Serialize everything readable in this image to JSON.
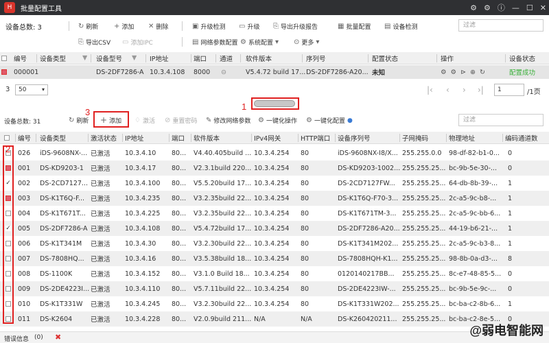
{
  "window": {
    "title": "批量配置工具",
    "controls": [
      "⚙",
      "⚙",
      "ⓘ",
      "—",
      "☐",
      "✕"
    ]
  },
  "top_toolbar": {
    "device_total_label": "设备总数: 3",
    "refresh": "刷新",
    "add": "添加",
    "delete": "删除",
    "upgrade_check": "升级检测",
    "upgrade": "升级",
    "export_report": "导出升级报告",
    "batch_config": "批量配置",
    "device_check": "设备检测",
    "export_csv": "导出CSV",
    "add_ipc": "添加IPC",
    "net_params": "网络参数配置",
    "sys_config": "系统配置",
    "more": "更多",
    "filter_placeholder": "过滤"
  },
  "top_table": {
    "headers": [
      "编号",
      "设备类型",
      "设备型号",
      "IP地址",
      "端口",
      "通道",
      "软件版本",
      "序列号",
      "配置状态",
      "操作",
      "设备状态"
    ],
    "rows": [
      {
        "num": "000001",
        "type": "",
        "model": "DS-2DF7286-A",
        "ip": "10.3.4.108",
        "port": "8000",
        "channel": "",
        "version": "V5.4.72 build 17...",
        "serial": "DS-2DF7286-A20...",
        "config_status": "未知",
        "status": "配置成功"
      }
    ]
  },
  "pager": {
    "page_num": "3",
    "page_size": "50",
    "current_page": "1",
    "total_pages": "/1页"
  },
  "lower_toolbar": {
    "device_total_label": "设备总数: 31",
    "refresh": "刷新",
    "add": "添加",
    "activate": "激活",
    "reset_pwd": "重置密码",
    "edit_net": "修改网络参数",
    "one_key_op": "一键化操作",
    "one_key_config": "一键化配置",
    "filter_placeholder": "过滤"
  },
  "lower_table": {
    "headers": [
      "编号",
      "设备类型",
      "激活状态",
      "IP地址",
      "端口",
      "软件版本",
      "IPv4网关",
      "HTTP端口",
      "设备序列号",
      "子网掩码",
      "物理地址",
      "编码通道数"
    ],
    "rows": [
      {
        "check": "none",
        "num": "026",
        "type": "iDS-9608NX-...",
        "act": "已激活",
        "ip": "10.3.4.10",
        "port": "80...",
        "ver": "V4.40.405build ...",
        "gw": "10.3.4.254",
        "http": "80",
        "sn": "iDS-9608NX-I8/X...",
        "mask": "255.255.0.0",
        "mac": "98-df-82-b1-0...",
        "ch": "0"
      },
      {
        "check": "red",
        "num": "001",
        "type": "DS-KD9203-1",
        "act": "已激活",
        "ip": "10.3.4.17",
        "port": "80...",
        "ver": "V2.3.1build 220...",
        "gw": "10.3.4.254",
        "http": "80",
        "sn": "DS-KD9203-1002...",
        "mask": "255.255.25...",
        "mac": "bc-9b-5e-30-...",
        "ch": "0"
      },
      {
        "check": "tick",
        "num": "002",
        "type": "DS-2CD7127...",
        "act": "已激活",
        "ip": "10.3.4.100",
        "port": "80...",
        "ver": "V5.5.20build 17...",
        "gw": "10.3.4.254",
        "http": "80",
        "sn": "DS-2CD7127FW...",
        "mask": "255.255.25...",
        "mac": "64-db-8b-39-...",
        "ch": "1"
      },
      {
        "check": "red",
        "num": "003",
        "type": "DS-K1T6Q-F...",
        "act": "已激活",
        "ip": "10.3.4.235",
        "port": "80...",
        "ver": "V3.2.35build 22...",
        "gw": "10.3.4.254",
        "http": "80",
        "sn": "DS-K1T6Q-F70-3...",
        "mask": "255.255.25...",
        "mac": "2c-a5-9c-b8-...",
        "ch": "1"
      },
      {
        "check": "none",
        "num": "004",
        "type": "DS-K1T671T...",
        "act": "已激活",
        "ip": "10.3.4.225",
        "port": "80...",
        "ver": "V3.2.35build 22...",
        "gw": "10.3.4.254",
        "http": "80",
        "sn": "DS-K1T671TM-3...",
        "mask": "255.255.25...",
        "mac": "2c-a5-9c-bb-6...",
        "ch": "1"
      },
      {
        "check": "tick",
        "num": "005",
        "type": "DS-2DF7286-A",
        "act": "已激活",
        "ip": "10.3.4.108",
        "port": "80...",
        "ver": "V5.4.72build 17...",
        "gw": "10.3.4.254",
        "http": "80",
        "sn": "DS-2DF7286-A20...",
        "mask": "255.255.25...",
        "mac": "44-19-b6-21-...",
        "ch": "1"
      },
      {
        "check": "none",
        "num": "006",
        "type": "DS-K1T341M",
        "act": "已激活",
        "ip": "10.3.4.30",
        "port": "80...",
        "ver": "V3.2.30build 22...",
        "gw": "10.3.4.254",
        "http": "80",
        "sn": "DS-K1T341M202...",
        "mask": "255.255.25...",
        "mac": "2c-a5-9c-b3-8...",
        "ch": "1"
      },
      {
        "check": "none",
        "num": "007",
        "type": "DS-7808HQ...",
        "act": "已激活",
        "ip": "10.3.4.16",
        "port": "80...",
        "ver": "V3.5.38build 18...",
        "gw": "10.3.4.254",
        "http": "80",
        "sn": "DS-7808HQH-K1...",
        "mask": "255.255.25...",
        "mac": "98-8b-0a-d3-...",
        "ch": "8"
      },
      {
        "check": "none",
        "num": "008",
        "type": "DS-1100K",
        "act": "已激活",
        "ip": "10.3.4.152",
        "port": "80...",
        "ver": "V3.1.0 Build 18...",
        "gw": "10.3.4.254",
        "http": "80",
        "sn": "0120140217BB...",
        "mask": "255.255.25...",
        "mac": "8c-e7-48-85-5...",
        "ch": "0"
      },
      {
        "check": "none",
        "num": "009",
        "type": "DS-2DE4223I...",
        "act": "已激活",
        "ip": "10.3.4.110",
        "port": "80...",
        "ver": "V5.7.11build 22...",
        "gw": "10.3.4.254",
        "http": "80",
        "sn": "DS-2DE4223IW-...",
        "mask": "255.255.25...",
        "mac": "bc-9b-5e-9c-...",
        "ch": "0"
      },
      {
        "check": "none",
        "num": "010",
        "type": "DS-K1T331W",
        "act": "已激活",
        "ip": "10.3.4.245",
        "port": "80...",
        "ver": "V3.2.30build 22...",
        "gw": "10.3.4.254",
        "http": "80",
        "sn": "DS-K1T331W202...",
        "mask": "255.255.25...",
        "mac": "bc-ba-c2-8b-6...",
        "ch": "1"
      },
      {
        "check": "none",
        "num": "011",
        "type": "DS-K2604",
        "act": "已激活",
        "ip": "10.3.4.228",
        "port": "80...",
        "ver": "V2.0.9build 211...",
        "gw": "N/A",
        "http": "N/A",
        "sn": "DS-K260420211...",
        "mask": "255.255.25...",
        "mac": "bc-ba-c2-8e-5...",
        "ch": "0"
      }
    ]
  },
  "annotations": {
    "one": "1",
    "two": "2",
    "three": "3"
  },
  "statusbar": {
    "error_label": "错误信息",
    "error_count": "(0)"
  },
  "watermark": "@弱电智能网",
  "colors": {
    "titlebar": "#2f3033",
    "annotation": "#e02020",
    "success": "#3ab03a"
  }
}
